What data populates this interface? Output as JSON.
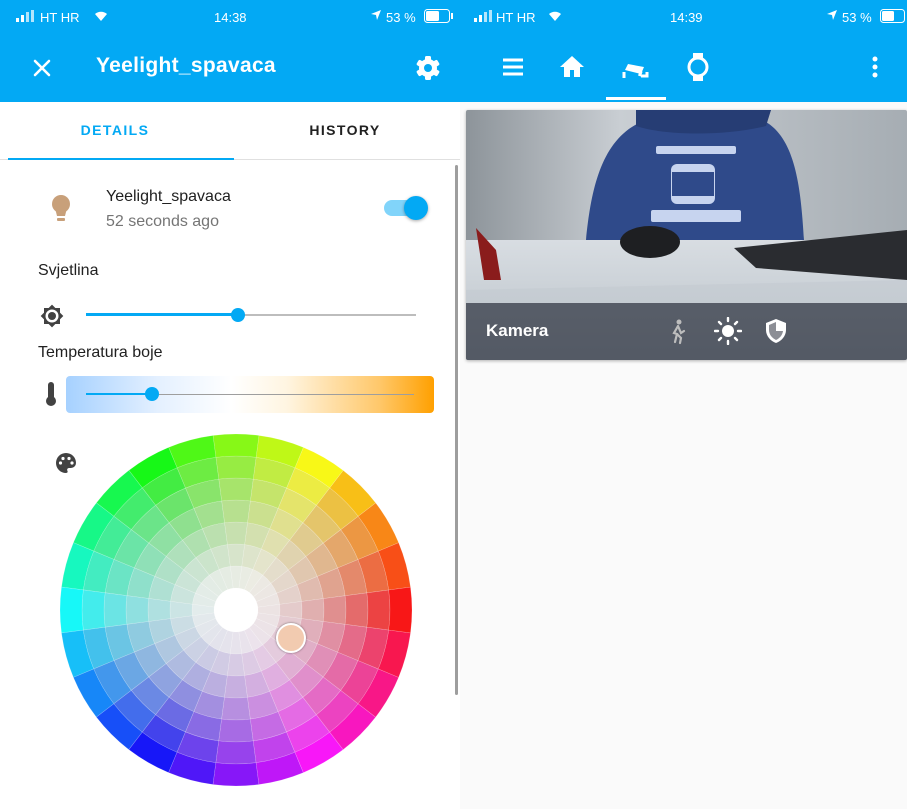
{
  "left_status": {
    "carrier": "HT HR",
    "time": "14:38",
    "battery": "53 %"
  },
  "right_status": {
    "carrier": "HT HR",
    "time": "14:39",
    "battery": "53 %"
  },
  "dialog": {
    "title": "Yeelight_spavaca",
    "close_icon": "close-icon",
    "settings_icon": "gear-icon",
    "tabs": [
      {
        "label": "DETAILS",
        "active": true
      },
      {
        "label": "HISTORY",
        "active": false
      }
    ],
    "entity": {
      "icon": "lightbulb-icon",
      "name": "Yeelight_spavaca",
      "last_changed": "52 seconds ago",
      "state_on": true
    },
    "brightness": {
      "label": "Svjetlina",
      "icon": "brightness-icon",
      "value_fraction": 0.46
    },
    "color_temp": {
      "label": "Temperatura boje",
      "icon": "thermometer-icon",
      "value_fraction": 0.2
    },
    "color_wheel": {
      "icon": "palette-icon",
      "selected_color": "#f2cbb0"
    }
  },
  "right_nav": {
    "icons": [
      "menu-icon",
      "home-icon",
      "cctv-icon",
      "watch-icon",
      "dots-vertical-icon"
    ],
    "active_index": 2
  },
  "camera_card": {
    "name": "Kamera",
    "icons": [
      "motion-icon",
      "brightness-sun-icon",
      "shield-icon"
    ]
  },
  "colors": {
    "primary": "#03a9f4",
    "toggle_track": "#81d4fa",
    "text_secondary": "#757575"
  }
}
